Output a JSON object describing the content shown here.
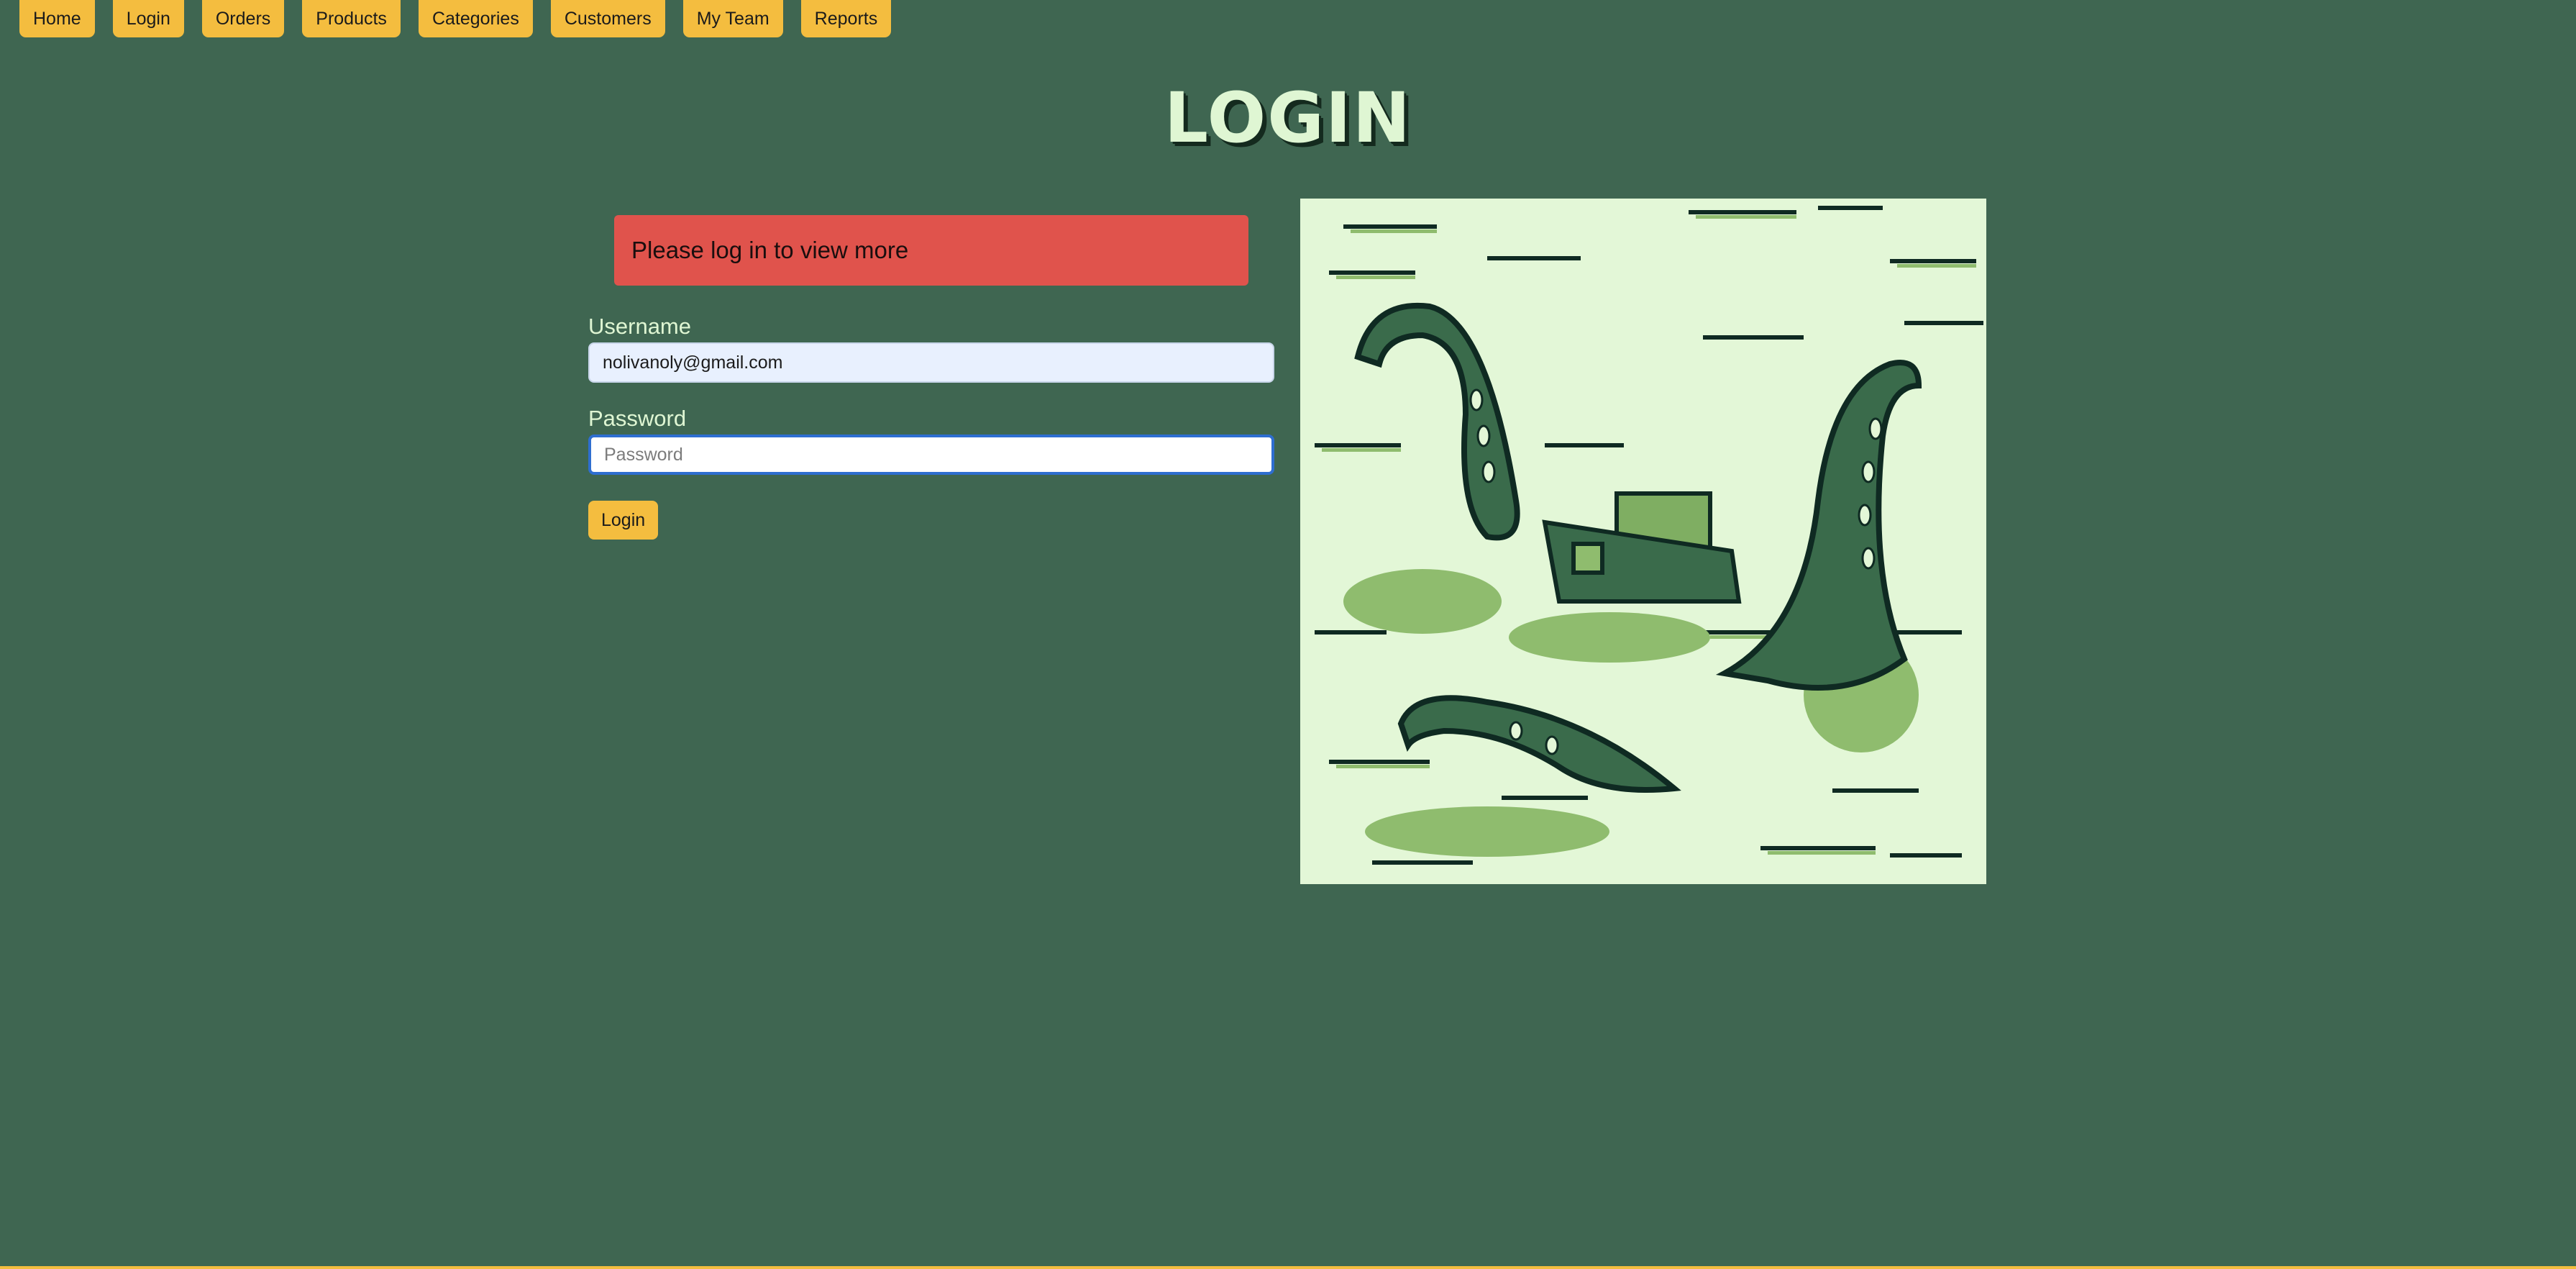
{
  "nav": {
    "items": [
      "Home",
      "Login",
      "Orders",
      "Products",
      "Categories",
      "Customers",
      "My Team",
      "Reports"
    ]
  },
  "page": {
    "title": "LOGIN"
  },
  "alert": {
    "message": "Please log in to view more"
  },
  "form": {
    "username_label": "Username",
    "username_value": "nolivanoly@gmail.com",
    "password_label": "Password",
    "password_placeholder": "Password",
    "submit_label": "Login"
  },
  "illustration": {
    "subject": "kraken-tentacles-sinking-ship"
  },
  "colors": {
    "background": "#3f6651",
    "accent": "#f4bd3f",
    "alert": "#e0534c",
    "title": "#dff6d3"
  }
}
